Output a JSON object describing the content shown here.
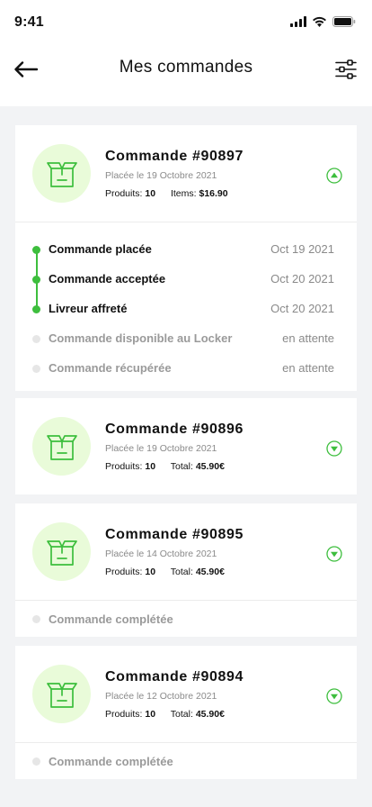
{
  "status_bar": {
    "time": "9:41"
  },
  "header": {
    "title": "Mes commandes"
  },
  "colors": {
    "accent": "#3DBE3D",
    "icon_bg": "#E9FBD9",
    "pending": "#E6E6E6"
  },
  "orders": [
    {
      "title": "Commande #90897",
      "date": "Placée le 19 Octobre 2021",
      "products_label": "Produits:",
      "products_value": "10",
      "total_label": "Items:",
      "total_value": "$16.90",
      "expanded": true,
      "timeline": [
        {
          "label": "Commande placée",
          "date": "Oct 19 2021",
          "done": true
        },
        {
          "label": "Commande acceptée",
          "date": "Oct 20 2021",
          "done": true
        },
        {
          "label": "Livreur affreté",
          "date": "Oct 20 2021",
          "done": true
        },
        {
          "label": "Commande disponible au Locker",
          "date": "en attente",
          "done": false
        },
        {
          "label": "Commande récupérée",
          "date": "en attente",
          "done": false
        }
      ]
    },
    {
      "title": "Commande #90896",
      "date": "Placée le 19 Octobre 2021",
      "products_label": "Produits:",
      "products_value": "10",
      "total_label": "Total:",
      "total_value": "45.90€",
      "expanded": false
    },
    {
      "title": "Commande #90895",
      "date": "Placée le 14 Octobre 2021",
      "products_label": "Produits:",
      "products_value": "10",
      "total_label": "Total:",
      "total_value": "45.90€",
      "expanded": false,
      "status": "Commande complétée"
    },
    {
      "title": "Commande #90894",
      "date": "Placée le 12 Octobre 2021",
      "products_label": "Produits:",
      "products_value": "10",
      "total_label": "Total:",
      "total_value": "45.90€",
      "expanded": false,
      "status": "Commande complétée"
    }
  ]
}
